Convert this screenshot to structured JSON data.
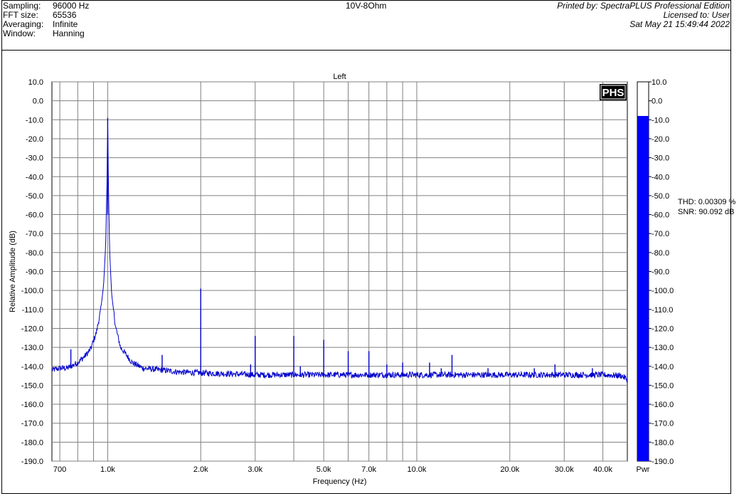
{
  "header": {
    "settings": [
      {
        "label": "Sampling:",
        "value": "96000 Hz"
      },
      {
        "label": "FFT size:",
        "value": "65536"
      },
      {
        "label": "Averaging:",
        "value": "Infinite"
      },
      {
        "label": "Window:",
        "value": "Hanning"
      }
    ],
    "title": "10V-8Ohm",
    "printed_by": "Printed by: SpectraPLUS Professional Edition",
    "licensed_to": "Licensed to: User",
    "date": "Sat May 21 15:49:44 2022"
  },
  "logo_text": "PHS",
  "measurements": {
    "thd": "THD: 0.00309 %",
    "snr": "SNR: 90.092 dB"
  },
  "colors": {
    "trace": "#0000cc",
    "bar": "#0000ff",
    "grid": "#808080"
  },
  "chart_data": {
    "type": "line",
    "title": "Left",
    "xlabel": "Frequency (Hz)",
    "ylabel": "Relative Amplitude (dB)",
    "xscale": "log",
    "xlim": [
      660,
      48000
    ],
    "ylim": [
      -190,
      10
    ],
    "x_ticks": [
      {
        "value": 700,
        "label": "700"
      },
      {
        "value": 1000,
        "label": "1.0k"
      },
      {
        "value": 2000,
        "label": "2.0k"
      },
      {
        "value": 3000,
        "label": "3.0k"
      },
      {
        "value": 5000,
        "label": "5.0k"
      },
      {
        "value": 7000,
        "label": "7.0k"
      },
      {
        "value": 10000,
        "label": "10.0k"
      },
      {
        "value": 20000,
        "label": "20.0k"
      },
      {
        "value": 30000,
        "label": "30.0k"
      },
      {
        "value": 40000,
        "label": "40.0k"
      }
    ],
    "x_gridlines": [
      700,
      800,
      900,
      1000,
      2000,
      3000,
      4000,
      5000,
      6000,
      7000,
      8000,
      9000,
      10000,
      20000,
      30000,
      40000
    ],
    "y_ticks": [
      10,
      0,
      -10,
      -20,
      -30,
      -40,
      -50,
      -60,
      -70,
      -80,
      -90,
      -100,
      -110,
      -120,
      -130,
      -140,
      -150,
      -160,
      -170,
      -180,
      -190
    ],
    "y_tick_labels": [
      "10.0",
      "0.0",
      "-10.0",
      "-20.0",
      "-30.0",
      "-40.0",
      "-50.0",
      "-60.0",
      "-70.0",
      "-80.0",
      "-90.0",
      "-100.0",
      "-110.0",
      "-120.0",
      "-130.0",
      "-140.0",
      "-150.0",
      "-160.0",
      "-170.0",
      "-180.0",
      "-190.0"
    ],
    "grid": true,
    "series": [
      {
        "x": [
          660,
          700,
          720,
          740,
          760,
          800,
          840,
          880,
          920,
          950,
          970,
          985,
          995,
          1000,
          1005,
          1015,
          1030,
          1060,
          1100,
          1200,
          1300,
          1500,
          1700,
          2000,
          2500,
          3000,
          4000,
          5000,
          7000,
          10000,
          15000,
          20000,
          30000,
          40000,
          46000,
          48000
        ],
        "y": [
          -142,
          -141,
          -141,
          -141,
          -140,
          -138,
          -135,
          -131,
          -122,
          -110,
          -97,
          -76,
          -42,
          -9,
          -42,
          -80,
          -102,
          -119,
          -130,
          -138,
          -141,
          -142,
          -143,
          -143.5,
          -144,
          -144.5,
          -144.5,
          -144.5,
          -144.5,
          -144.5,
          -144.5,
          -144.5,
          -144.5,
          -144.5,
          -145,
          -147
        ]
      }
    ],
    "spurs": [
      {
        "x": 760,
        "y": -131
      },
      {
        "x": 1500,
        "y": -134
      },
      {
        "x": 2000,
        "y": -99
      },
      {
        "x": 2900,
        "y": -139
      },
      {
        "x": 3000,
        "y": -124
      },
      {
        "x": 4000,
        "y": -124
      },
      {
        "x": 4200,
        "y": -140
      },
      {
        "x": 5000,
        "y": -126
      },
      {
        "x": 6000,
        "y": -132
      },
      {
        "x": 7000,
        "y": -132
      },
      {
        "x": 8000,
        "y": -139
      },
      {
        "x": 9000,
        "y": -138
      },
      {
        "x": 11000,
        "y": -138
      },
      {
        "x": 12000,
        "y": -141
      },
      {
        "x": 13000,
        "y": -134
      },
      {
        "x": 17000,
        "y": -141
      },
      {
        "x": 24000,
        "y": -141
      },
      {
        "x": 28000,
        "y": -139
      },
      {
        "x": 37000,
        "y": -141
      }
    ]
  },
  "level_bar": {
    "label": "Pwr",
    "level_db": -8,
    "ylim": [
      -190,
      10
    ],
    "tick_labels": [
      "10.0",
      "0.0",
      "-10.0",
      "-20.0",
      "-30.0",
      "-40.0",
      "-50.0",
      "-60.0",
      "-70.0",
      "-80.0",
      "-90.0",
      "-100.0",
      "-110.0",
      "-120.0",
      "-130.0",
      "-140.0",
      "-150.0",
      "-160.0",
      "-170.0",
      "-180.0",
      "-190.0"
    ]
  }
}
